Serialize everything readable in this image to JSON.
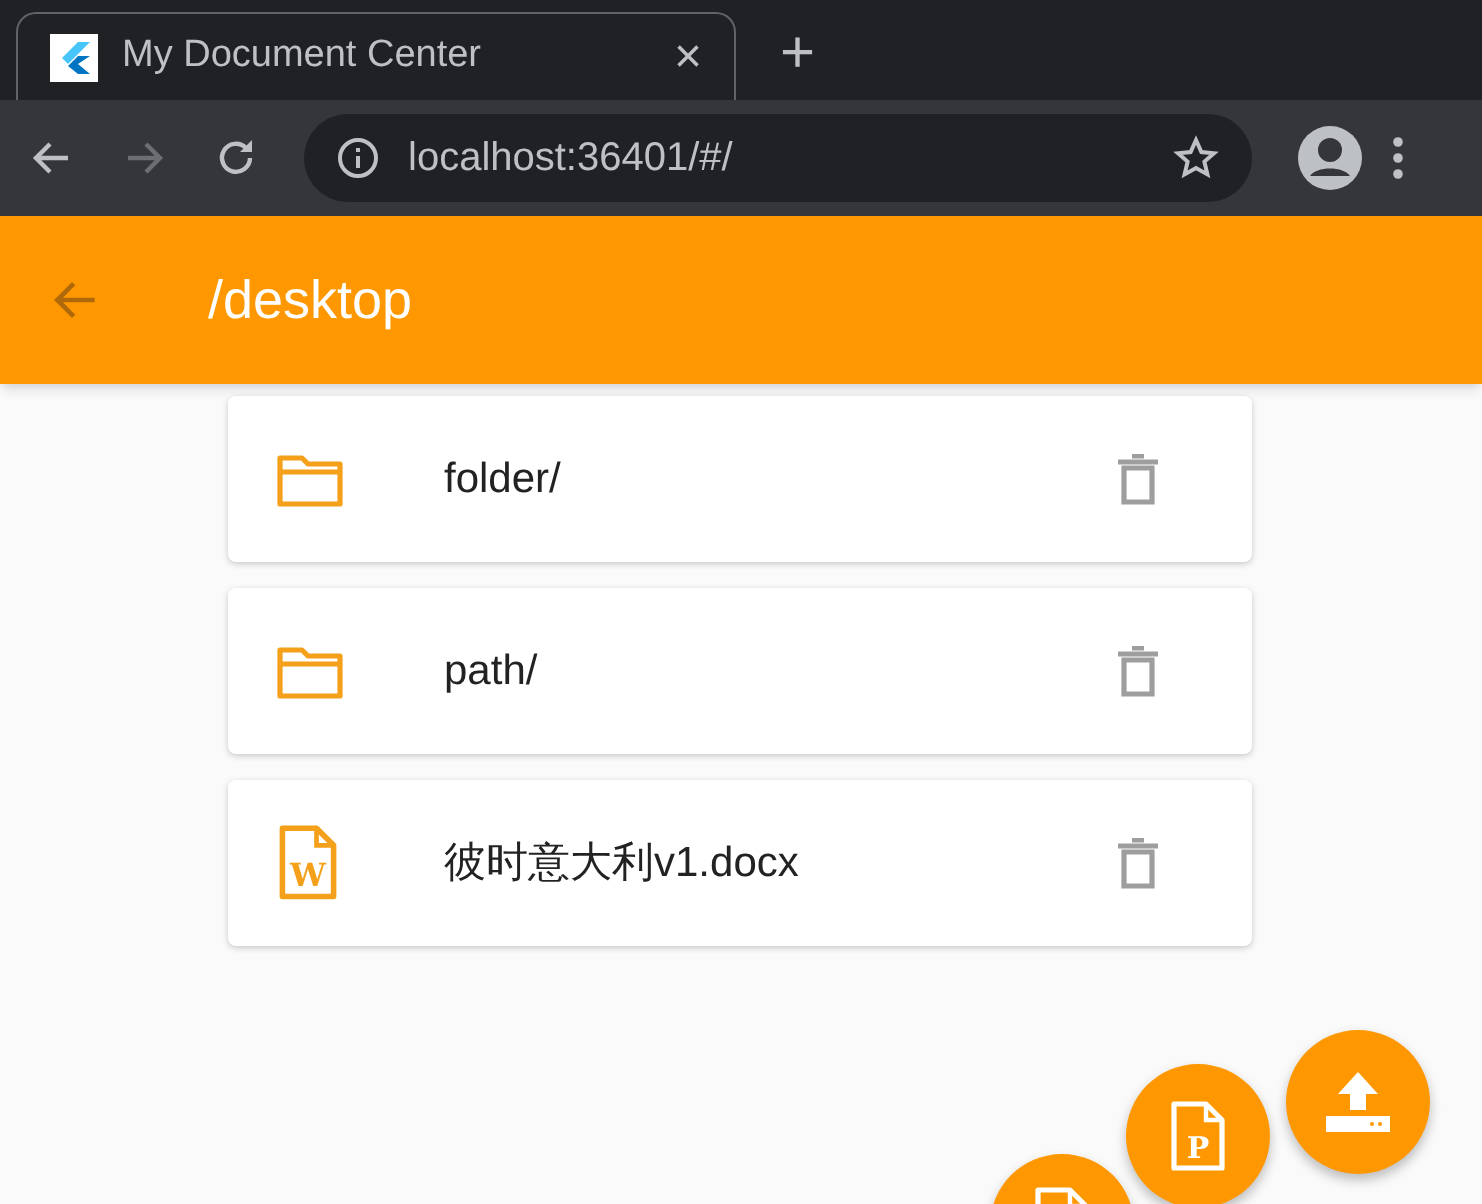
{
  "browser": {
    "tab": {
      "title": "My Document Center",
      "close": "×"
    },
    "new_tab": "+",
    "address": "localhost:36401/#/"
  },
  "app_bar": {
    "title": "/desktop"
  },
  "items": [
    {
      "kind": "folder",
      "name": "folder/"
    },
    {
      "kind": "folder",
      "name": "path/"
    },
    {
      "kind": "word",
      "name": "彼时意大利v1.docx",
      "letter": "W"
    }
  ],
  "fabs": [
    {
      "kind": "upload"
    },
    {
      "kind": "doc",
      "letter": "P"
    },
    {
      "kind": "doc"
    }
  ]
}
